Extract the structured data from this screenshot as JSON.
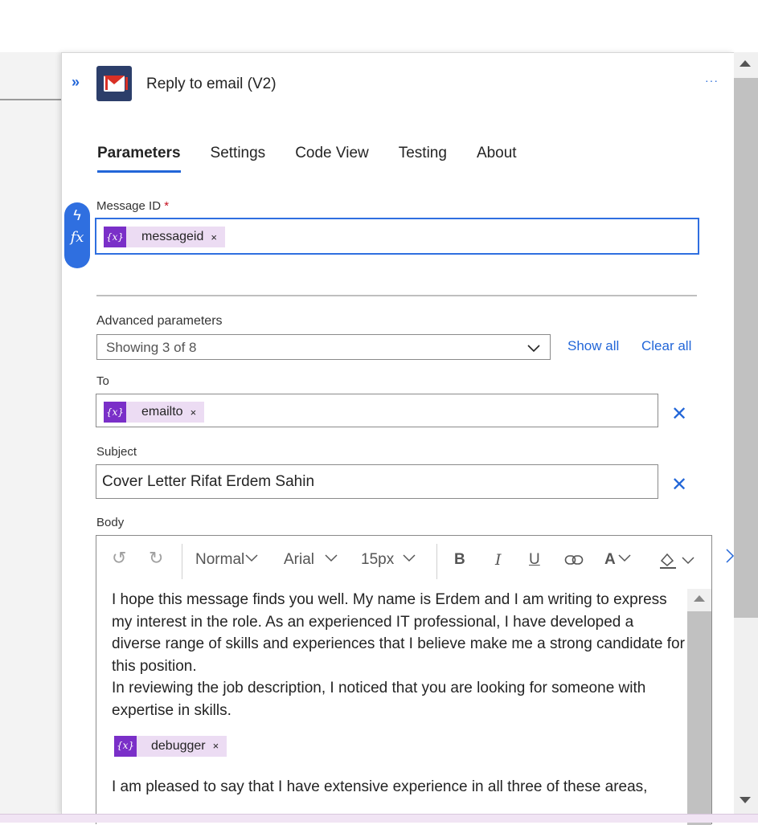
{
  "panel": {
    "title": "Reply to email (V2)",
    "more": "···",
    "collapse": "»"
  },
  "tabs": [
    {
      "label": "Parameters",
      "active": true
    },
    {
      "label": "Settings"
    },
    {
      "label": "Code View"
    },
    {
      "label": "Testing"
    },
    {
      "label": "About"
    }
  ],
  "message_id": {
    "label": "Message ID",
    "required_mark": "*",
    "token": "messageid",
    "token_icon": "{x}",
    "remove": "×"
  },
  "advanced": {
    "label": "Advanced parameters",
    "select_value": "Showing 3 of 8",
    "show_all": "Show all",
    "clear_all": "Clear all"
  },
  "to": {
    "label": "To",
    "token": "emailto",
    "token_icon": "{x}",
    "remove": "×",
    "clear": "✕"
  },
  "subject": {
    "label": "Subject",
    "value": "Cover Letter Rifat Erdem Sahin",
    "clear": "✕"
  },
  "body": {
    "label": "Body",
    "toolbar": {
      "undo": "↺",
      "redo": "↻",
      "style": "Normal",
      "font": "Arial",
      "size": "15px",
      "bold": "B",
      "italic": "I",
      "underline": "U",
      "link_icon": "link-icon",
      "font_color": "A",
      "highlight_icon": "highlight-icon"
    },
    "paragraph1": "I hope this message finds you well. My name is Erdem and I am writing to express my interest in the role. As an experienced IT professional, I have developed a diverse range of skills and experiences that I believe make me a strong candidate for this position.",
    "paragraph2": "In reviewing the job description, I noticed that you are looking for someone with expertise in skills.",
    "token": "debugger",
    "token_icon": "{x}",
    "remove": "×",
    "paragraph3": "I am pleased to say that I have extensive experience in all three of these areas,"
  },
  "colors": {
    "accent": "#2266d8",
    "token_bg": "#ecdcf3",
    "token_icon_bg": "#7a2fc8",
    "required": "#c50f1f"
  }
}
